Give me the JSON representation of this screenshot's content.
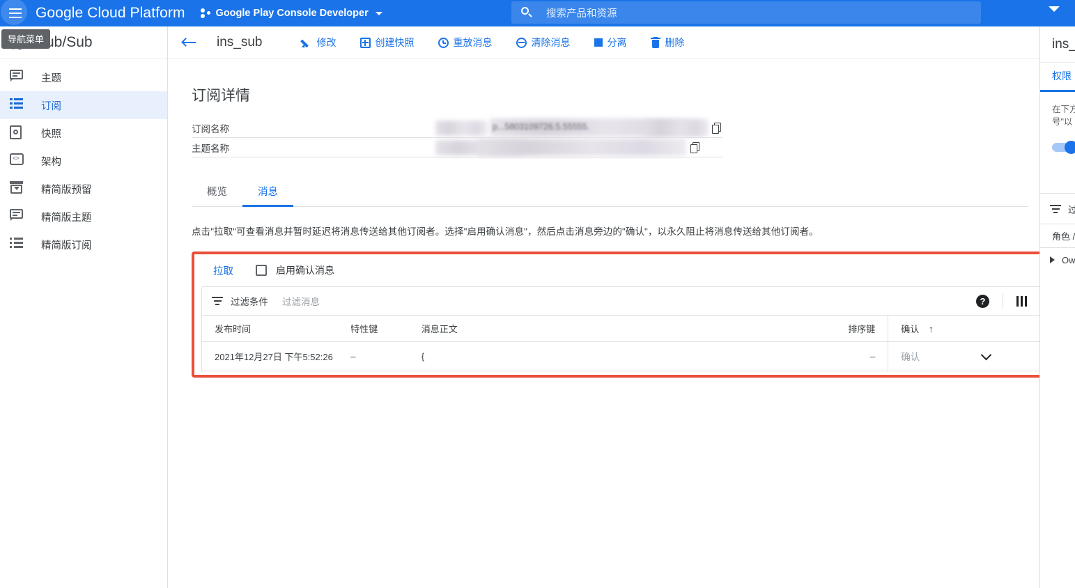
{
  "topbar": {
    "menu_tooltip": "导航菜单",
    "brand": "Google Cloud Platform",
    "project": "Google Play Console Developer",
    "search_placeholder": "搜索产品和资源"
  },
  "sidebar": {
    "product_title": "Pub/Sub",
    "items": [
      {
        "label": "主题",
        "icon": "chat-icon",
        "active": false
      },
      {
        "label": "订阅",
        "icon": "list-icon",
        "active": true
      },
      {
        "label": "快照",
        "icon": "snapshot-icon",
        "active": false
      },
      {
        "label": "架构",
        "icon": "code-icon",
        "active": false
      },
      {
        "label": "精简版预留",
        "icon": "archive-icon",
        "active": false
      },
      {
        "label": "精简版主题",
        "icon": "chat-icon",
        "active": false
      },
      {
        "label": "精简版订阅",
        "icon": "list-icon",
        "active": false
      }
    ]
  },
  "action_bar": {
    "back_label": "back-arrow",
    "page_name": "ins_sub",
    "actions": [
      {
        "label": "修改",
        "icon": "pencil-icon"
      },
      {
        "label": "创建快照",
        "icon": "snapshot-icon"
      },
      {
        "label": "重放消息",
        "icon": "clock-icon"
      },
      {
        "label": "清除消息",
        "icon": "minus-circle-icon"
      },
      {
        "label": "分离",
        "icon": "square-icon"
      },
      {
        "label": "删除",
        "icon": "trash-icon"
      }
    ]
  },
  "details": {
    "title": "订阅详情",
    "rows": [
      {
        "label": "订阅名称",
        "value": "",
        "redacted": true,
        "ghost": "p...5803109726.5.55555."
      },
      {
        "label": "主题名称",
        "value": "",
        "redacted": true,
        "ghost": ""
      }
    ]
  },
  "tabs": [
    {
      "label": "概览",
      "active": false
    },
    {
      "label": "消息",
      "active": true
    }
  ],
  "hint": "点击\"拉取\"可查看消息并暂时延迟将消息传送给其他订阅者。选择\"启用确认消息\"，然后点击消息旁边的\"确认\"，以永久阻止将消息传送给其他订阅者。",
  "pull_section": {
    "pull_label": "拉取",
    "ack_checkbox_label": "启用确认消息",
    "ack_checked": false,
    "highlight_color": "#ea4f39"
  },
  "filter_bar": {
    "filter_label": "过滤条件",
    "filter_placeholder": "过滤消息",
    "help_glyph": "?",
    "columns_icon": "columns-icon"
  },
  "messages_table": {
    "columns": [
      {
        "key": "publish_time",
        "label": "发布时间"
      },
      {
        "key": "attribute_key",
        "label": "特性键"
      },
      {
        "key": "message_body",
        "label": "消息正文"
      },
      {
        "key": "ordering_key",
        "label": "排序键"
      },
      {
        "key": "ack",
        "label": "确认",
        "sort": "↑"
      }
    ],
    "rows": [
      {
        "publish_time": "2021年12月27日 下午5:52:26",
        "attribute_key": "–",
        "message_body": "{",
        "ordering_key": "–",
        "ack_label": "确认"
      }
    ]
  },
  "right_panel": {
    "title": "ins_",
    "tab": "权限",
    "description_line1": "在下方",
    "description_line2": "号\"以",
    "toggle_on": true,
    "filter_label": "过",
    "column_header": "角色 /",
    "row_label": "Ow"
  },
  "colors": {
    "brand_blue": "#1a73e8",
    "accent_red": "#ea4f39",
    "active_nav_bg": "#e8f0fe",
    "text_primary": "#3c4043",
    "text_secondary": "#5f6368",
    "text_muted": "#9aa0a6"
  }
}
